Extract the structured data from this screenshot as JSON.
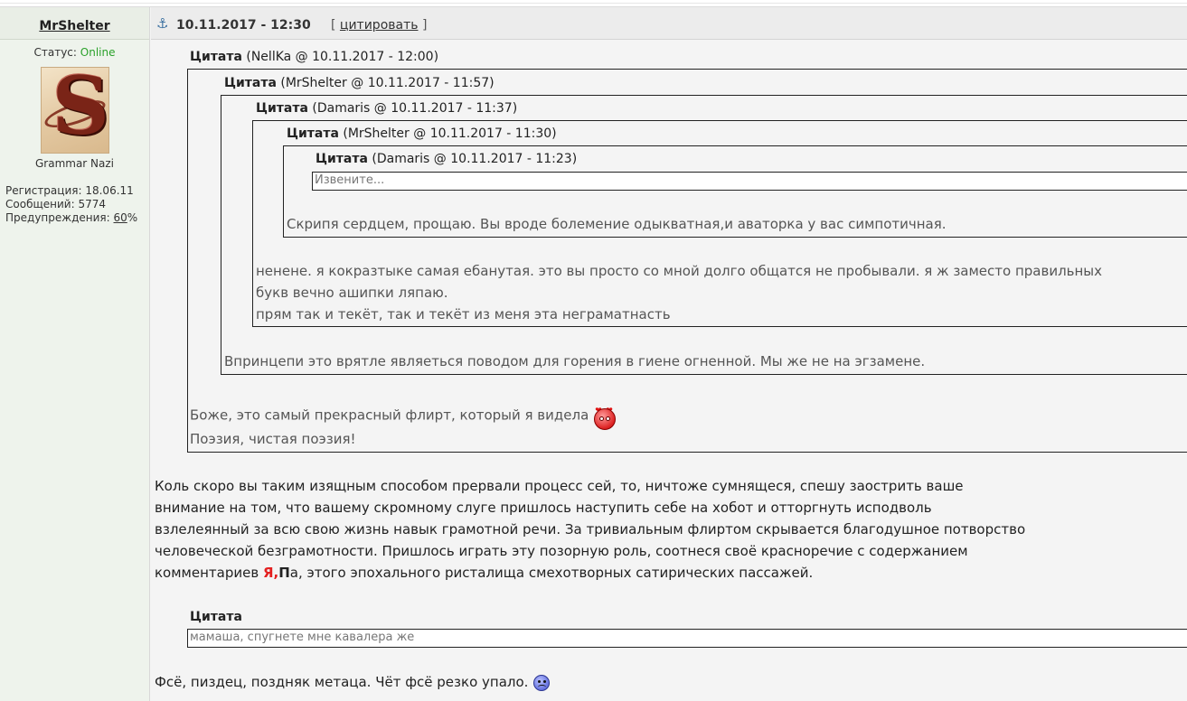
{
  "author": {
    "name": "MrShelter",
    "status_label": "Статус:",
    "status_value": "Online",
    "rank": "Grammar Nazi",
    "reg_label": "Регистрация:",
    "reg_value": "18.06.11",
    "posts_label": "Сообщений:",
    "posts_value": "5774",
    "warn_label": "Предупреждения:",
    "warn_value": "60",
    "warn_suffix": "%"
  },
  "post": {
    "datetime": "10.11.2017 - 12:30",
    "cite_open": "[",
    "cite_label": "цитировать",
    "cite_close": "]"
  },
  "quotes": [
    {
      "label": "Цитата",
      "meta": "(NellKa @ 10.11.2017 - 12:00)"
    },
    {
      "label": "Цитата",
      "meta": "(MrShelter @ 10.11.2017 - 11:57)"
    },
    {
      "label": "Цитата",
      "meta": "(Damaris @ 10.11.2017 - 11:37)"
    },
    {
      "label": "Цитата",
      "meta": "(MrShelter @ 10.11.2017 - 11:30)"
    },
    {
      "label": "Цитата",
      "meta": "(Damaris @ 10.11.2017 - 11:23)"
    }
  ],
  "quote_texts": {
    "q5": "Извените...",
    "q4": "Скрипя сердцем, прощаю. Вы вроде болемение одыкватная,и аваторка у вас симпотичная.",
    "q3_l1": "ненене. я кокразтыке самая ебанутая. это вы просто со мной долго общатся не пробывали. я ж заместо правильных",
    "q3_l2": "букв вечно ашипки ляпаю.",
    "q3_l3": "прям так и текёт, так и текёт из меня эта неграматнасть",
    "q2": "Впринцепи это врятле являеться поводом для горения в гиене огненной. Мы же не на эгзамене.",
    "q1_l1": "Боже, это самый прекрасный флирт, который я видела",
    "q1_l2": "Поэзия, чистая поэзия!"
  },
  "body": {
    "l1": "Коль скоро вы таким изящным способом прервали процесс сей, то, ничтоже сумнящеся, спешу заострить ваше",
    "l2": "внимание на том, что вашему скромному слуге пришлось наступить себе на хобот и отторгнуть исподволь",
    "l3": "взлелеянный за всю свою жизнь навык грамотной речи. За тривиальным флиртом скрывается благодушное потворство",
    "l4": "человеческой безграмотности. Пришлось играть эту позорную роль, соотнеся своё красноречие с содержанием",
    "l5_pre": "комментариев ",
    "l5_ya": "Я",
    "l5_comma": ",",
    "l5_p": "П",
    "l5_post": "а, этого эпохального ристалища смехотворных сатирических пассажей."
  },
  "second_quote": {
    "label": "Цитата",
    "text": "мамаша, спугнете мне кавалера же"
  },
  "footer_line": "Фсё, пиздец, поздняк метаца. Чёт фсё резко упало.",
  "icons": {
    "anchor": "anchor-icon",
    "love": "love-smiley-icon",
    "sad": "sad-smiley-icon"
  },
  "colors": {
    "online": "#2aa12a",
    "accent_red": "#e32020",
    "anchor": "#3a6fa0"
  }
}
